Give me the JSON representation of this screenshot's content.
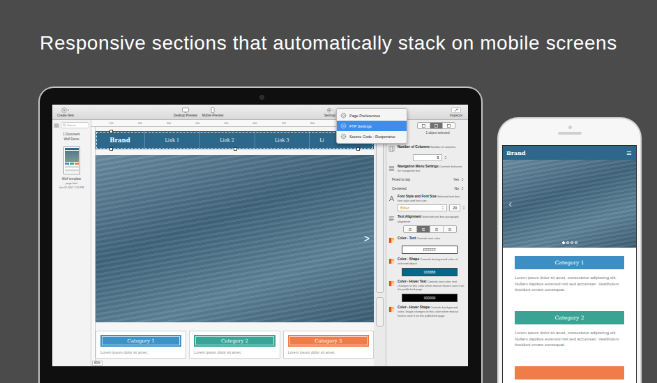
{
  "headline": "Responsive sections that automatically stack on mobile screens",
  "app": {
    "toolbar": {
      "create": "Create New",
      "previews": [
        "Desktop Preview",
        "Mobile Preview"
      ],
      "settings": "Settings",
      "inspector": "Inspector"
    },
    "settings_menu": [
      {
        "label": "Page Preferences",
        "selected": false
      },
      {
        "label": "FTP Settings",
        "selected": true
      },
      {
        "label": "Source Code - Responsive",
        "selected": false
      }
    ],
    "sidebar": {
      "search": "Search",
      "count": "1 Document",
      "project": "Wolf Demo",
      "page": {
        "name": "Wolf template",
        "file": "page.html",
        "date": "Jan 02 2017 7:45 PM"
      }
    },
    "ruler": [
      "100",
      "200",
      "300",
      "400",
      "500",
      "600",
      "700",
      "800",
      "900",
      "1000"
    ],
    "page": {
      "brand": "Brand",
      "links": [
        "Link 1",
        "Link 2",
        "Link 3",
        "Li"
      ],
      "next": ">",
      "categories": [
        {
          "label": "Category 1",
          "color": "#3b93c7",
          "text": "Lorem ipsum dolor sit amet,"
        },
        {
          "label": "Category 2",
          "color": "#38a596",
          "text": "Lorem ipsum dolor sit amet,"
        },
        {
          "label": "Category 3",
          "color": "#f07c4a",
          "text": "Lorem ipsum dolor sit amet,"
        }
      ]
    },
    "zoom": "80%",
    "inspector": {
      "tabs": [
        {
          "selected": false
        },
        {
          "selected": true
        },
        {
          "selected": false
        }
      ],
      "status": "1 object selected",
      "rows": [
        {
          "kind": "stepper",
          "title": "Number of Columns",
          "desc": "Number of columns",
          "value": "5"
        },
        {
          "kind": "header",
          "title": "Navigation Menu Settings",
          "desc": "Controls behavior for navigation bar"
        },
        {
          "kind": "select",
          "title": "Fixed to top",
          "value": "Yes"
        },
        {
          "kind": "select",
          "title": "Centered",
          "value": "No"
        },
        {
          "kind": "font",
          "title": "Font Style and Font Size",
          "desc": "Selected text box font style and font size.",
          "font": "Bitter",
          "size": "20"
        },
        {
          "kind": "align",
          "title": "Text Alignment",
          "desc": "Selected text box paragraph alignment",
          "options": [
            {
              "selected": false
            },
            {
              "selected": true
            },
            {
              "selected": false
            },
            {
              "selected": false
            }
          ]
        },
        {
          "kind": "color",
          "title": "Color - Text",
          "desc": "Controls text color",
          "value": "FFFFFF",
          "color": "#ffffff"
        },
        {
          "kind": "color",
          "title": "Color - Shape",
          "desc": "Controls background color of selected object",
          "value": "006888",
          "color": "#006888"
        },
        {
          "kind": "color",
          "title": "Color - Hover Text",
          "desc": "Controls text color, text changes to this color when mouse hovers over it on the published page",
          "value": "000000",
          "color": "#000000"
        },
        {
          "kind": "note",
          "title": "Color - Hover Shape",
          "desc": "Controls background color, shape changes to this color when mouse hovers over it on the published page"
        }
      ]
    }
  },
  "phone": {
    "brand": "Brand",
    "prev": "‹",
    "dots": [
      {
        "selected": true
      },
      {
        "selected": false
      },
      {
        "selected": false
      },
      {
        "selected": false
      }
    ],
    "items": [
      {
        "label": "Category 1",
        "color": "#3d8fc3",
        "text": "Lorem ipsum dolor sit amet, consectetur adipiscing elit. Nullam dapibus euismod nisl sed accumsan. Vestibulum tincidunt ornare consequat."
      },
      {
        "label": "Category 2",
        "color": "#3aa394",
        "text": "Lorem ipsum dolor sit amet, consectetur adipiscing elit. Nullam dapibus euismod nisl sed accumsan. Vestibulum tincidunt ornare consequat."
      },
      {
        "color": "#f07d48"
      }
    ]
  }
}
